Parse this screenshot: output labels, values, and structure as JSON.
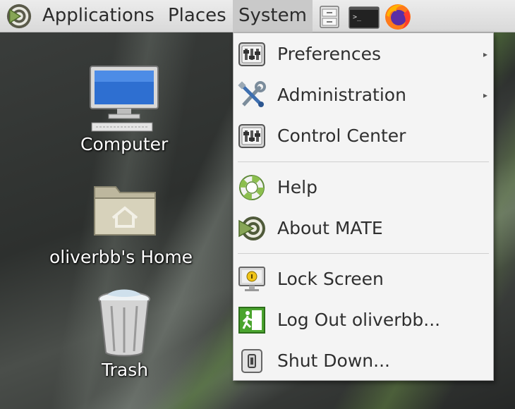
{
  "panel": {
    "menus": [
      {
        "label": "Applications"
      },
      {
        "label": "Places"
      },
      {
        "label": "System"
      }
    ],
    "launchers": [
      {
        "icon": "file-manager-icon"
      },
      {
        "icon": "terminal-icon"
      },
      {
        "icon": "firefox-icon"
      }
    ]
  },
  "desktop": {
    "icons": [
      {
        "label": "Computer",
        "icon": "computer-icon"
      },
      {
        "label": "oliverbb's Home",
        "icon": "home-folder-icon"
      },
      {
        "label": "Trash",
        "icon": "trash-icon"
      }
    ]
  },
  "system_menu": {
    "items": [
      {
        "label": "Preferences",
        "icon": "preferences-icon",
        "submenu": true
      },
      {
        "label": "Administration",
        "icon": "administration-icon",
        "submenu": true
      },
      {
        "label": "Control Center",
        "icon": "control-center-icon",
        "submenu": false
      },
      {
        "label": "Help",
        "icon": "help-icon",
        "submenu": false
      },
      {
        "label": "About MATE",
        "icon": "mate-logo-icon",
        "submenu": false
      },
      {
        "label": "Lock Screen",
        "icon": "lock-screen-icon",
        "submenu": false
      },
      {
        "label": "Log Out oliverbb...",
        "icon": "log-out-icon",
        "submenu": false
      },
      {
        "label": "Shut Down...",
        "icon": "shut-down-icon",
        "submenu": false
      }
    ],
    "submenu_arrow": "▸"
  },
  "colors": {
    "panel_bg": "#e3e3e3",
    "menu_bg": "#f4f4f4",
    "mate_green": "#87a556"
  }
}
